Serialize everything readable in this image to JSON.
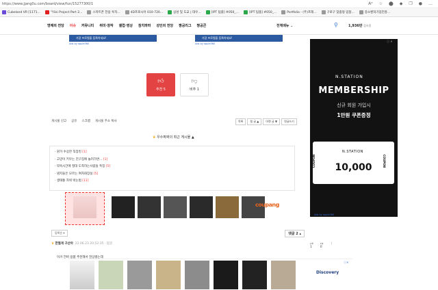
{
  "browser": {
    "url": "https://www.jjang0u.com/board/view/fun/15277300/1",
    "bookmarks": [
      {
        "label": "Cubeland VR [1171...",
        "color": "#6c4ad8"
      },
      {
        "label": "\"Yiisi Project Part 2...",
        "color": "#e02020"
      },
      {
        "label": "스마트폰 전용 투자...",
        "color": "#999999"
      },
      {
        "label": "4D프로시어 010-720...",
        "color": "#999999"
      },
      {
        "label": "삼성 및 도교 | 대우...",
        "color": "#2ba84a"
      },
      {
        "label": "[IPT 팀플] #050_...",
        "color": "#2ba84a"
      },
      {
        "label": "[IPT 팀플] #050_...",
        "color": "#2ba84a"
      },
      {
        "label": "Portfolio - (주)프레...",
        "color": "#999999"
      },
      {
        "label": "구로구 맞춤형 입찰...",
        "color": "#999999"
      },
      {
        "label": "중소벤처기업진흥...",
        "color": "#999999"
      }
    ]
  },
  "nav": {
    "menu": [
      "명예의 전당",
      "이슈",
      "커뮤니티",
      "취미·창작",
      "셀럽·영상",
      "참치파파",
      "성인의 전당",
      "짱공리그",
      "짱공콘"
    ],
    "hot_index": 1,
    "total_menu": "전체메뉴",
    "stat": "1,936만",
    "stat_label": "접속중"
  },
  "ads_top": {
    "left_text": "가장 프로필을 등록하세요!",
    "right_text": "가장 프로필을 등록하세요!",
    "adsby_left": "Ads by oppie360",
    "adsby_right": "Ads by oppie360"
  },
  "vote": {
    "up_label": "추천 5",
    "down_label": "비추 1"
  },
  "actions": [
    "게시물 신고",
    "공유",
    "스크랩",
    "게시물 주소 복사"
  ],
  "right_buttons": [
    "목록",
    "윗 글 ▲",
    "아랫 글 ▼",
    "댓글쓰기"
  ],
  "recent_header": "우수짜짜의 최근 게시물",
  "recent_posts": [
    {
      "title": "원가 수상한 직장킹",
      "count": "[1]"
    },
    {
      "title": "고양이 키우는 친구집에 놀러가면...",
      "count": "[1]"
    },
    {
      "title": "약속시간에 절대 도착하는사람들 특징",
      "count": "[5]"
    },
    {
      "title": "냄지들은 모르는 여자화장실",
      "count": "[5]"
    },
    {
      "title": "생태통 자위 박눈법",
      "count": "[11]"
    }
  ],
  "shop_ad_brand": "coupang",
  "sort_select": "등록순",
  "comment_count": "댓글 2",
  "comment": {
    "name": "한절게 구산아",
    "meta": "22.06.23 20:52:35 · 답글",
    "likes": "1",
    "dislikes": "0",
    "text": "이거 전버 용품 추천해서 현상랬는데"
  },
  "sidebar_ad": {
    "logo": "N.STATION",
    "title": "MEMBERSHIP",
    "sub1": "신규 회원 가입시",
    "sub2": "1만원 쿠폰증정",
    "ticket_logo": "N.STATION",
    "amount": "10,000",
    "coupon": "COUPON",
    "adsby": "Ads by oppie360"
  },
  "bottom_ad_brand": "Discovery"
}
